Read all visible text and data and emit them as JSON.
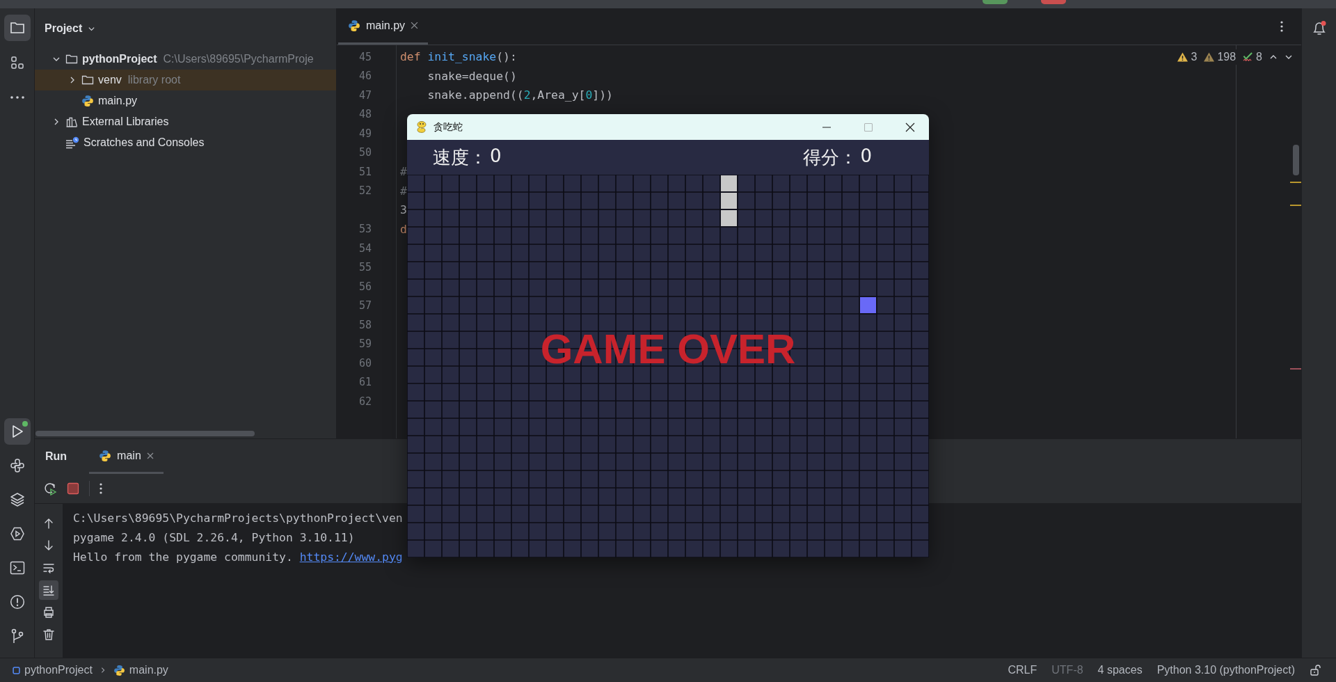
{
  "activity_bar": {
    "top": [
      {
        "kind": "project",
        "selected": true
      },
      {
        "kind": "structure",
        "selected": false
      },
      {
        "kind": "more",
        "selected": false
      }
    ],
    "bottom": [
      {
        "kind": "run",
        "selected": true
      },
      {
        "kind": "python-console",
        "selected": false
      },
      {
        "kind": "packages",
        "selected": false
      },
      {
        "kind": "services",
        "selected": false
      },
      {
        "kind": "terminal",
        "selected": false
      },
      {
        "kind": "problems",
        "selected": false
      },
      {
        "kind": "git",
        "selected": false
      }
    ]
  },
  "project_panel": {
    "title": "Project",
    "tree": [
      {
        "label": "pythonProject",
        "hint": "C:\\Users\\89695\\PycharmProje",
        "kind": "project",
        "expanded": true,
        "children": [
          {
            "label": "venv",
            "hint": "library root",
            "kind": "library-root",
            "expanded": false
          },
          {
            "label": "main.py",
            "kind": "python"
          }
        ]
      },
      {
        "label": "External Libraries",
        "kind": "libraries",
        "expanded": false
      },
      {
        "label": "Scratches and Consoles",
        "kind": "scratches"
      }
    ]
  },
  "editor": {
    "tabs": [
      {
        "label": "main.py",
        "selected": true
      }
    ],
    "inspections": [
      {
        "kind": "warning",
        "count": "3"
      },
      {
        "kind": "weak-warning",
        "count": "198"
      },
      {
        "kind": "typo",
        "count": "8"
      }
    ],
    "lines": [
      {
        "number": "45",
        "code": [
          {
            "text": "def ",
            "kind": "keyword"
          },
          {
            "text": "init_snake",
            "kind": "function"
          },
          {
            "text": "():",
            "kind": "plain"
          }
        ]
      },
      {
        "number": "46",
        "code": [
          {
            "text": "    snake=deque()",
            "kind": "plain"
          }
        ]
      },
      {
        "number": "47",
        "code": [
          {
            "text": "    snake.append((",
            "kind": "plain"
          },
          {
            "text": "2",
            "kind": "number"
          },
          {
            "text": ",Area_y[",
            "kind": "plain"
          },
          {
            "text": "0",
            "kind": "number"
          },
          {
            "text": "]))",
            "kind": "plain"
          }
        ]
      },
      {
        "number": "48"
      },
      {
        "number": "49"
      },
      {
        "number": "50"
      },
      {
        "number": "51",
        "code": [
          {
            "text": "#",
            "kind": "comment"
          }
        ]
      },
      {
        "number": "52",
        "code": [
          {
            "text": "#",
            "kind": "comment"
          }
        ]
      },
      {
        "code": [
          {
            "text": "3",
            "kind": "plain"
          }
        ]
      },
      {
        "number": "53",
        "code": [
          {
            "text": "d",
            "kind": "keyword"
          }
        ]
      },
      {
        "number": "54"
      },
      {
        "number": "55"
      },
      {
        "number": "56"
      },
      {
        "number": "57"
      },
      {
        "number": "58"
      },
      {
        "number": "59"
      },
      {
        "number": "60"
      },
      {
        "number": "61"
      },
      {
        "number": "62"
      }
    ]
  },
  "run_panel": {
    "title": "Run",
    "tabs": [
      {
        "label": "main",
        "selected": true
      }
    ],
    "tools": [
      {
        "kind": "up",
        "selected": false
      },
      {
        "kind": "down",
        "selected": false
      },
      {
        "kind": "wrap",
        "selected": false
      },
      {
        "kind": "scroll-end",
        "selected": true
      },
      {
        "kind": "print",
        "selected": false
      },
      {
        "kind": "trash",
        "selected": false
      }
    ],
    "console": [
      {
        "text": "C:\\Users\\89695\\PycharmProjects\\pythonProject\\ven"
      },
      {
        "text": "pygame 2.4.0 (SDL 2.26.4, Python 3.10.11)"
      },
      {
        "text": "Hello from the pygame community. ",
        "link": "https://www.pyg"
      }
    ]
  },
  "game_window": {
    "title": "贪吃蛇",
    "maximize_disabled": true,
    "hud": [
      {
        "label": "速度：",
        "value": "0"
      },
      {
        "label": "得分：",
        "value": "0"
      }
    ],
    "message": "GAME OVER"
  },
  "status_bar": {
    "breadcrumbs": [
      {
        "label": "pythonProject",
        "kind": "module"
      },
      {
        "label": "main.py",
        "kind": "python"
      }
    ],
    "items": [
      {
        "label": "CRLF",
        "disabled": false
      },
      {
        "label": "UTF-8",
        "disabled": true
      },
      {
        "label": "4 spaces",
        "disabled": false
      },
      {
        "label": "Python 3.10 (pythonProject)",
        "disabled": false
      }
    ]
  }
}
